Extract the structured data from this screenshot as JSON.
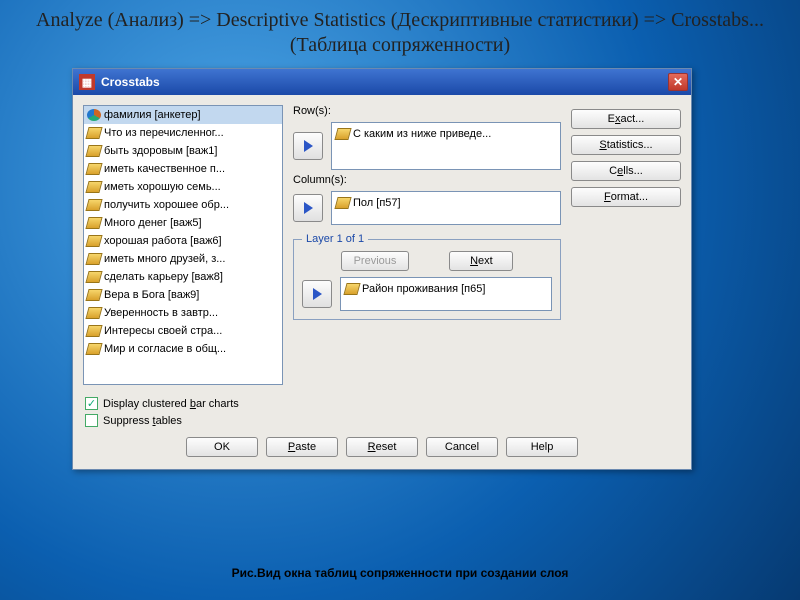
{
  "slide": {
    "title": "Analyze (Анализ) => Descriptive Statistics (Дескриптивные статистики) => Crosstabs... (Таблица сопряженности)",
    "caption": "Рис.Вид окна таблиц сопряженности при создании слоя"
  },
  "dialog": {
    "title": "Crosstabs",
    "close": "✕",
    "variables": [
      {
        "icon": "nominal",
        "label": "фамилия [анкетер]",
        "selected": true
      },
      {
        "icon": "ruler",
        "label": "Что из перечисленног..."
      },
      {
        "icon": "ruler",
        "label": "быть здоровым [важ1]"
      },
      {
        "icon": "ruler",
        "label": "иметь качественное п..."
      },
      {
        "icon": "ruler",
        "label": "иметь хорошую семь..."
      },
      {
        "icon": "ruler",
        "label": "получить хорошее обр..."
      },
      {
        "icon": "ruler",
        "label": "Много денег [важ5]"
      },
      {
        "icon": "ruler",
        "label": "хорошая работа [важ6]"
      },
      {
        "icon": "ruler",
        "label": "иметь много друзей, з..."
      },
      {
        "icon": "ruler",
        "label": "сделать карьеру [важ8]"
      },
      {
        "icon": "ruler",
        "label": "Вера в Бога [важ9]"
      },
      {
        "icon": "ruler",
        "label": "Уверенность в завтр..."
      },
      {
        "icon": "ruler",
        "label": "Интересы своей стра..."
      },
      {
        "icon": "ruler",
        "label": "Мир и согласие в общ..."
      }
    ],
    "rows_label": "Row(s):",
    "rows": [
      {
        "icon": "ruler",
        "label": "С каким из ниже приведе..."
      }
    ],
    "cols_label": "Column(s):",
    "cols": [
      {
        "icon": "ruler",
        "label": "Пол [п57]"
      }
    ],
    "layer": {
      "legend": "Layer 1 of 1",
      "prev": "Previous",
      "next": "Next",
      "items": [
        {
          "icon": "ruler",
          "label": "Район проживания [п65]"
        }
      ]
    },
    "side_buttons": {
      "exact": "Exact...",
      "statistics": "Statistics...",
      "cells": "Cells...",
      "format": "Format..."
    },
    "checks": {
      "display_clustered": {
        "label": "Display clustered bar charts",
        "checked": true
      },
      "suppress_tables": {
        "label": "Suppress tables",
        "checked": false
      }
    },
    "footer": {
      "ok": "OK",
      "paste": "Paste",
      "reset": "Reset",
      "cancel": "Cancel",
      "help": "Help"
    }
  }
}
